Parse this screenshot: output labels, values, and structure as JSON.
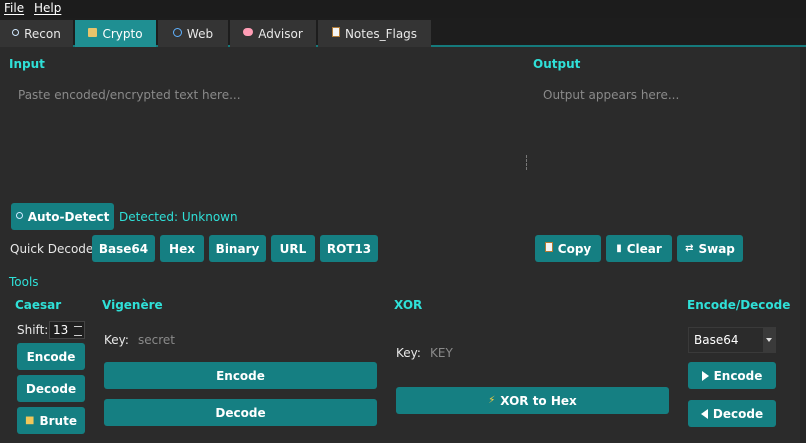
{
  "menu": {
    "file": "File",
    "help": "Help"
  },
  "tabs": [
    {
      "label": "Recon",
      "icon": "search-icon"
    },
    {
      "label": "Crypto",
      "icon": "book-icon"
    },
    {
      "label": "Web",
      "icon": "globe-icon"
    },
    {
      "label": "Advisor",
      "icon": "brain-icon"
    },
    {
      "label": "Notes_Flags",
      "icon": "memo-icon"
    }
  ],
  "input": {
    "label": "Input",
    "placeholder": "Paste encoded/encrypted text here..."
  },
  "output": {
    "label": "Output",
    "placeholder": "Output appears here..."
  },
  "auto_detect": {
    "label": "Auto-Detect",
    "detected": "Detected: Unknown"
  },
  "quick_decode": {
    "label": "Quick Decode:",
    "buttons": [
      "Base64",
      "Hex",
      "Binary",
      "URL",
      "ROT13"
    ]
  },
  "actions": {
    "copy": "Copy",
    "clear": "Clear",
    "swap": "Swap"
  },
  "tools": {
    "label": "Tools",
    "caesar": {
      "title": "Caesar",
      "shift_label": "Shift:",
      "shift_value": "13",
      "encode": "Encode",
      "decode": "Decode",
      "brute": "Brute"
    },
    "vigenere": {
      "title": "Vigenère",
      "key_label": "Key:",
      "key_placeholder": "secret",
      "encode": "Encode",
      "decode": "Decode"
    },
    "xor": {
      "title": "XOR",
      "key_label": "Key:",
      "key_placeholder": "KEY",
      "button": "XOR to Hex"
    },
    "encode_decode": {
      "title": "Encode/Decode",
      "selected": "Base64",
      "encode": "Encode",
      "decode": "Decode"
    }
  },
  "colors": {
    "accent": "#157f82",
    "accent_text": "#2fe0d8",
    "background": "#2b2b2b"
  }
}
